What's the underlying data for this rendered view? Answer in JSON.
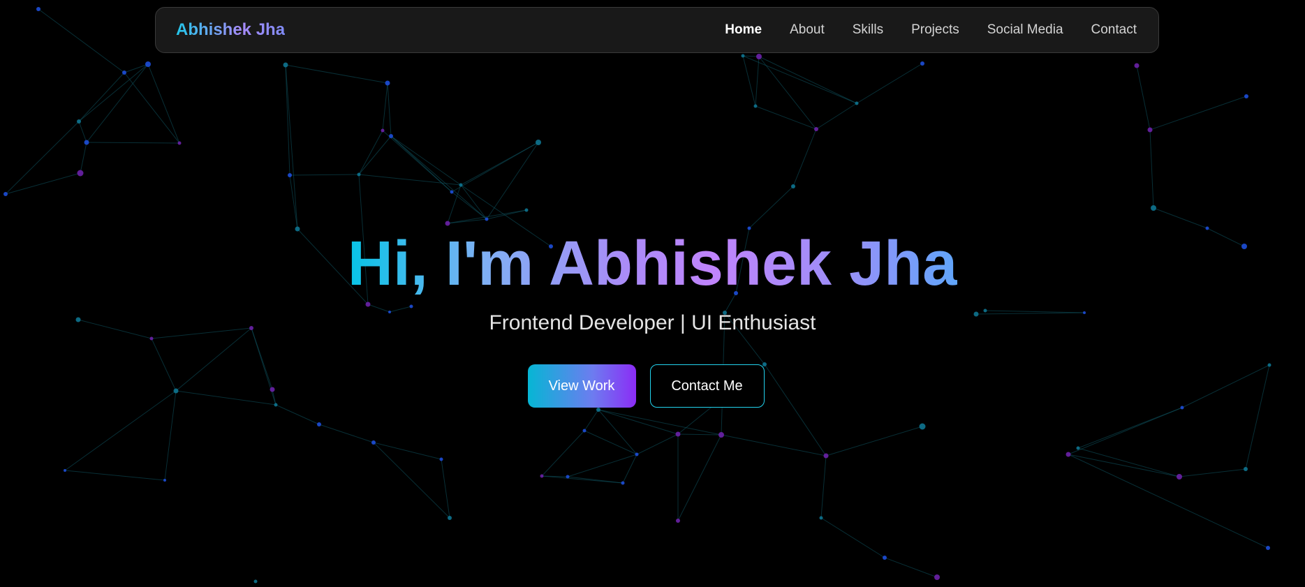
{
  "brand": {
    "name": "Abhishek Jha"
  },
  "nav": {
    "items": [
      {
        "label": "Home",
        "active": true
      },
      {
        "label": "About",
        "active": false
      },
      {
        "label": "Skills",
        "active": false
      },
      {
        "label": "Projects",
        "active": false
      },
      {
        "label": "Social Media",
        "active": false
      },
      {
        "label": "Contact",
        "active": false
      }
    ]
  },
  "hero": {
    "title": "Hi, I'm Abhishek Jha",
    "subtitle": "Frontend Developer | UI Enthusiast",
    "primary_button": "View Work",
    "secondary_button": "Contact Me"
  },
  "colors": {
    "background": "#000000",
    "accent_cyan": "#06b6d4",
    "accent_purple": "#8b2cf5",
    "node_teal": "#0e7490",
    "node_purple": "#6b21a8",
    "node_blue": "#1d4ed8"
  }
}
